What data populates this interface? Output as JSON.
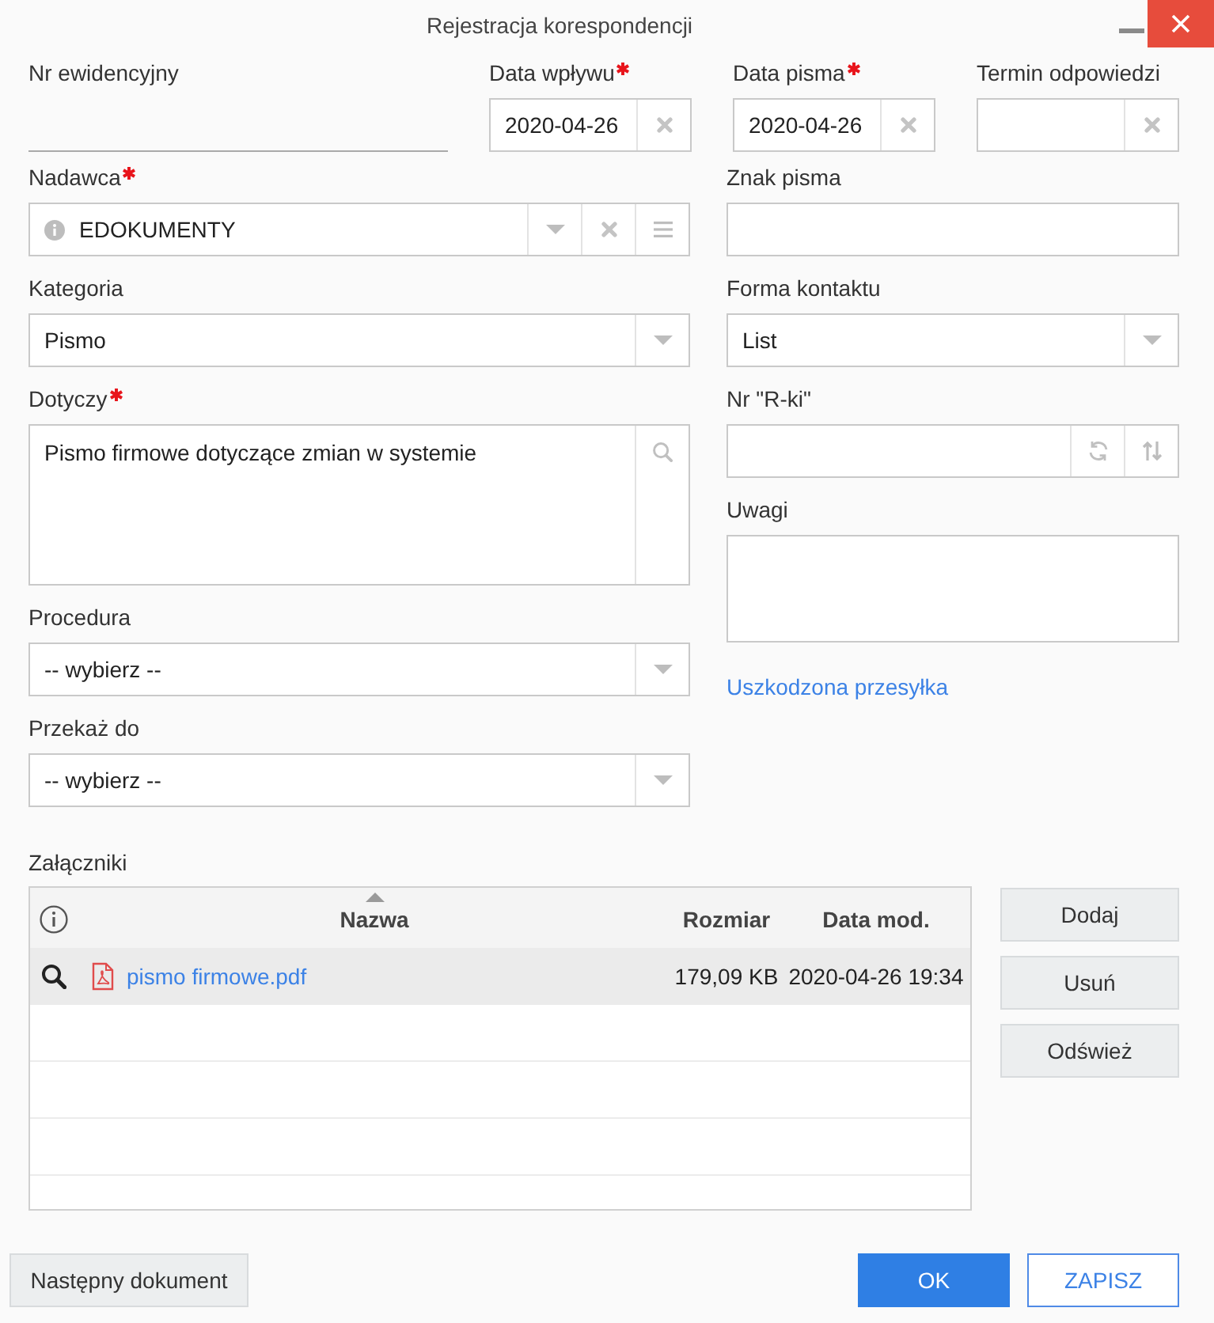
{
  "window": {
    "title": "Rejestracja korespondencji"
  },
  "top_fields": [
    {
      "kind": "underline",
      "label": "Nr ewidencyjny",
      "required": false
    },
    {
      "kind": "date",
      "label": "Data wpływu",
      "required": true,
      "value": "2020-04-26"
    },
    {
      "kind": "date",
      "label": "Data pisma",
      "required": true,
      "value": "2020-04-26"
    },
    {
      "kind": "date",
      "label": "Termin odpowiedzi",
      "required": false
    }
  ],
  "left_fields": [
    {
      "kind": "contact",
      "label": "Nadawca",
      "required": true,
      "value": "EDOKUMENTY"
    },
    {
      "kind": "select",
      "label": "Kategoria",
      "required": false,
      "value": "Pismo"
    },
    {
      "kind": "search_text",
      "label": "Dotyczy",
      "required": true,
      "value": "Pismo firmowe dotyczące zmian w systemie"
    },
    {
      "kind": "select",
      "label": "Procedura",
      "required": false,
      "value": "-- wybierz --"
    },
    {
      "kind": "select",
      "label": "Przekaż do",
      "required": false,
      "value": "-- wybierz --"
    }
  ],
  "right_fields": [
    {
      "kind": "text",
      "label": "Znak pisma",
      "required": false
    },
    {
      "kind": "select",
      "label": "Forma kontaktu",
      "required": false,
      "value": "List"
    },
    {
      "kind": "counter",
      "label": "Nr \"R-ki\"",
      "required": false
    },
    {
      "kind": "textarea",
      "label": "Uwagi",
      "required": false
    },
    {
      "kind": "link",
      "text": "Uszkodzona przesyłka"
    }
  ],
  "attachments": {
    "label": "Załączniki",
    "columns": [
      {
        "label": "Nazwa",
        "sorted": true
      },
      {
        "label": "Rozmiar",
        "sorted": false
      },
      {
        "label": "Data mod.",
        "sorted": false
      }
    ],
    "rows": [
      {
        "name": "pismo firmowe.pdf",
        "size": "179,09 KB",
        "modified": "2020-04-26 19:34",
        "selected": true
      }
    ],
    "buttons": [
      "Dodaj",
      "Usuń",
      "Odśwież"
    ]
  },
  "footer": {
    "next_button": "Następny dokument",
    "ok_button": "OK",
    "save_button": "ZAPISZ"
  }
}
